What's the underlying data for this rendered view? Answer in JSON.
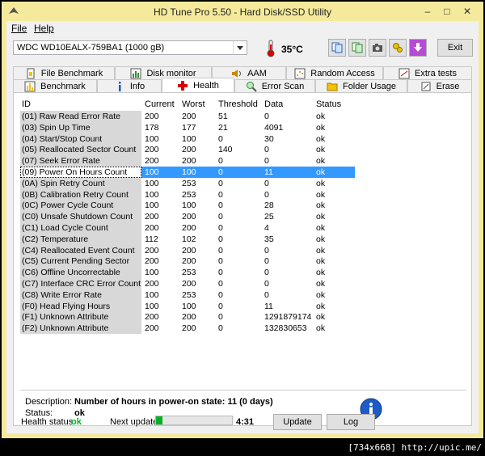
{
  "window": {
    "title": "HD Tune Pro 5.50 - Hard Disk/SSD Utility",
    "minimize": "–",
    "maximize": "□",
    "close": "✕"
  },
  "menu": {
    "file": "File",
    "help": "Help"
  },
  "device": {
    "selected": "WDC WD10EALX-759BA1 (1000 gB)",
    "temperature": "35°C"
  },
  "toolbar": {
    "exit_label": "Exit",
    "icons": [
      "copy-info-icon",
      "copy-text-icon",
      "screenshot-icon",
      "options-icon",
      "save-icon"
    ]
  },
  "tabs_top": [
    {
      "label": "File Benchmark",
      "icon": "file-benchmark-icon"
    },
    {
      "label": "Disk monitor",
      "icon": "disk-monitor-icon"
    },
    {
      "label": "AAM",
      "icon": "speaker-icon"
    },
    {
      "label": "Random Access",
      "icon": "random-access-icon"
    },
    {
      "label": "Extra tests",
      "icon": "extra-tests-icon"
    }
  ],
  "tabs_bottom": [
    {
      "label": "Benchmark",
      "icon": "benchmark-icon"
    },
    {
      "label": "Info",
      "icon": "info-icon"
    },
    {
      "label": "Health",
      "icon": "health-cross-icon",
      "active": true
    },
    {
      "label": "Error Scan",
      "icon": "magnifier-icon"
    },
    {
      "label": "Folder Usage",
      "icon": "folder-icon"
    },
    {
      "label": "Erase",
      "icon": "erase-icon"
    }
  ],
  "table": {
    "columns": [
      "ID",
      "Current",
      "Worst",
      "Threshold",
      "Data",
      "Status"
    ],
    "rows": [
      [
        "(01) Raw Read Error Rate",
        "200",
        "200",
        "51",
        "0",
        "ok"
      ],
      [
        "(03) Spin Up Time",
        "178",
        "177",
        "21",
        "4091",
        "ok"
      ],
      [
        "(04) Start/Stop Count",
        "100",
        "100",
        "0",
        "30",
        "ok"
      ],
      [
        "(05) Reallocated Sector Count",
        "200",
        "200",
        "140",
        "0",
        "ok"
      ],
      [
        "(07) Seek Error Rate",
        "200",
        "200",
        "0",
        "0",
        "ok"
      ],
      [
        "(09) Power On Hours Count",
        "100",
        "100",
        "0",
        "11",
        "ok"
      ],
      [
        "(0A) Spin Retry Count",
        "100",
        "253",
        "0",
        "0",
        "ok"
      ],
      [
        "(0B) Calibration Retry Count",
        "100",
        "253",
        "0",
        "0",
        "ok"
      ],
      [
        "(0C) Power Cycle Count",
        "100",
        "100",
        "0",
        "28",
        "ok"
      ],
      [
        "(C0) Unsafe Shutdown Count",
        "200",
        "200",
        "0",
        "25",
        "ok"
      ],
      [
        "(C1) Load Cycle Count",
        "200",
        "200",
        "0",
        "4",
        "ok"
      ],
      [
        "(C2) Temperature",
        "112",
        "102",
        "0",
        "35",
        "ok"
      ],
      [
        "(C4) Reallocated Event Count",
        "200",
        "200",
        "0",
        "0",
        "ok"
      ],
      [
        "(C5) Current Pending Sector",
        "200",
        "200",
        "0",
        "0",
        "ok"
      ],
      [
        "(C6) Offline Uncorrectable",
        "100",
        "253",
        "0",
        "0",
        "ok"
      ],
      [
        "(C7) Interface CRC Error Count",
        "200",
        "200",
        "0",
        "0",
        "ok"
      ],
      [
        "(C8) Write Error Rate",
        "100",
        "253",
        "0",
        "0",
        "ok"
      ],
      [
        "(F0) Head Flying Hours",
        "100",
        "100",
        "0",
        "11",
        "ok"
      ],
      [
        "(F1) Unknown Attribute",
        "200",
        "200",
        "0",
        "1291879174",
        "ok"
      ],
      [
        "(F2) Unknown Attribute",
        "200",
        "200",
        "0",
        "132830653",
        "ok"
      ]
    ],
    "selected_index": 5
  },
  "details": {
    "description_label": "Description:",
    "description": "Number of hours in power-on state: 11 (0 days)",
    "status_label": "Status:",
    "status": "ok"
  },
  "footer": {
    "health_label": "Health status:",
    "health_value": "ok",
    "next_update_label": "Next update:",
    "next_update_progress": 0.08,
    "next_update_time": "4:31",
    "update_label": "Update",
    "log_label": "Log"
  },
  "watermark": "[734x668] http://upic.me/",
  "colors": {
    "title_bg": "#f5ea9b",
    "selection": "#3399ff",
    "ok_green": "#06b025",
    "info_blue": "#1e5bc6"
  }
}
